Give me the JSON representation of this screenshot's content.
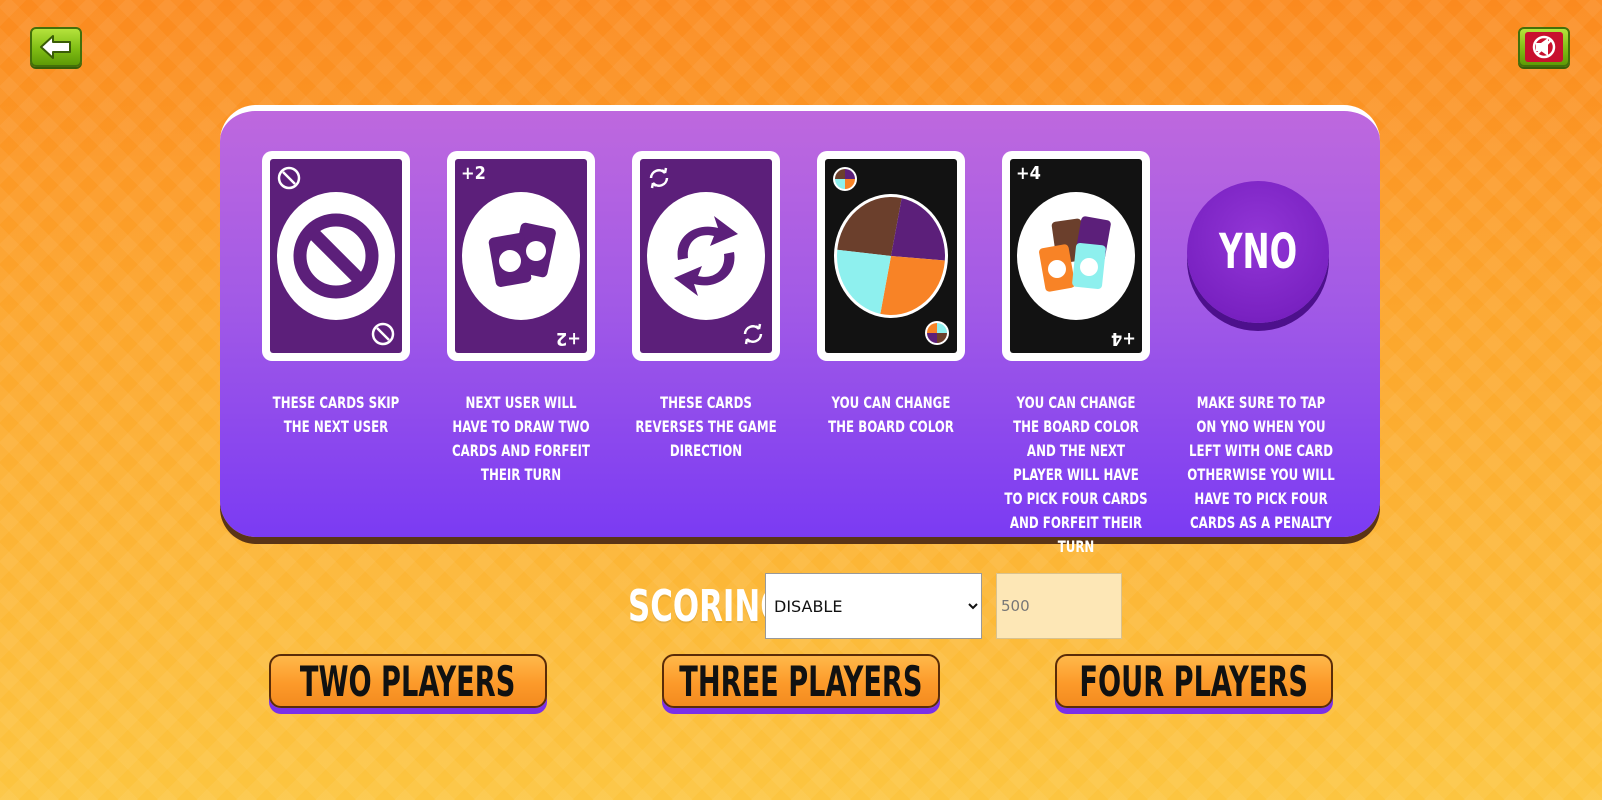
{
  "top_bar": {
    "back_icon": "back-arrow-icon",
    "mute_icon": "sound-muted-icon"
  },
  "rules": {
    "cards": [
      {
        "name": "skip-card",
        "corner": "⊘",
        "description": "THESE CARDS SKIP THE NEXT USER"
      },
      {
        "name": "draw-two-card",
        "corner": "+2",
        "description": "NEXT USER WILL HAVE TO DRAW TWO CARDS AND FORFEIT THEIR TURN"
      },
      {
        "name": "reverse-card",
        "corner": "⟲",
        "description": "THESE CARDS REVERSES THE GAME DIRECTION"
      },
      {
        "name": "wild-card",
        "corner": "",
        "description": "YOU CAN CHANGE THE BOARD COLOR"
      },
      {
        "name": "wild-draw-four-card",
        "corner": "+4",
        "description": "YOU CAN CHANGE THE BOARD COLOR AND THE NEXT PLAYER WILL HAVE TO PICK FOUR CARDS AND FORFEIT THEIR TURN"
      }
    ],
    "yno": {
      "label": "YNO",
      "description": "MAKE SURE TO TAP ON YNO WHEN YOU LEFT WITH ONE CARD OTHERWISE YOU WILL HAVE TO PICK FOUR CARDS AS A PENALTY"
    }
  },
  "scoring": {
    "label": "SCORING",
    "selected": "DISABLE",
    "options": [
      "DISABLE"
    ],
    "points_value": "500"
  },
  "players": {
    "two": "TWO PLAYERS",
    "three": "THREE PLAYERS",
    "four": "FOUR PLAYERS"
  },
  "colors": {
    "card_purple": "#5c1f7a",
    "card_black": "#121212",
    "wild_brown": "#6b3f2c",
    "wild_purple": "#5c1f7a",
    "wild_cyan": "#8ef0ee",
    "wild_orange": "#f88326",
    "yno_purple": "#7a22c2",
    "player_btn_orange": "#fc9a2a"
  }
}
